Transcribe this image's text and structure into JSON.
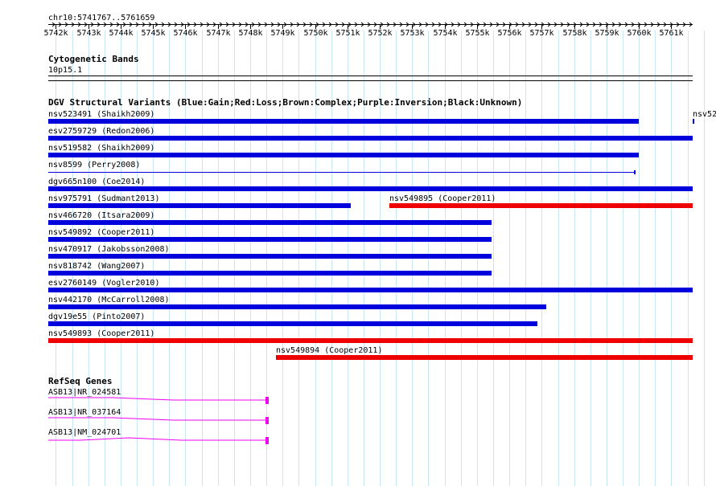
{
  "ruler": {
    "coord_label": "chr10:5741767..5761659",
    "start": 5741767,
    "end": 5761659,
    "ticks": [
      "5742k",
      "5743k",
      "5744k",
      "5745k",
      "5746k",
      "5747k",
      "5748k",
      "5749k",
      "5750k",
      "5751k",
      "5752k",
      "5753k",
      "5754k",
      "5755k",
      "5756k",
      "5757k",
      "5758k",
      "5759k",
      "5760k",
      "5761k"
    ]
  },
  "cytoband": {
    "title": "Cytogenetic Bands",
    "band": "10p15.1"
  },
  "dgv": {
    "title": "DGV Structural Variants (Blue:Gain;Red:Loss;Brown:Complex;Purple:Inversion;Black:Unknown)",
    "colors": {
      "gain": "#0000dd",
      "loss": "#ee0000"
    },
    "rows": [
      {
        "features": [
          {
            "label": "nsv523491 (Shaikh2009)",
            "start": 5741767,
            "end": 5760000,
            "type": "gain",
            "style": "thick"
          },
          {
            "label": "nsv52",
            "start": 5761670,
            "end": 5761700,
            "type": "gain",
            "style": "tiny"
          }
        ]
      },
      {
        "features": [
          {
            "label": "esv2759729 (Redon2006)",
            "start": 5741767,
            "end": 5761659,
            "type": "gain",
            "style": "thick"
          }
        ]
      },
      {
        "features": [
          {
            "label": "nsv519582 (Shaikh2009)",
            "start": 5741767,
            "end": 5760000,
            "type": "gain",
            "style": "thick"
          }
        ]
      },
      {
        "features": [
          {
            "label": "nsv8599 (Perry2008)",
            "start": 5741767,
            "end": 5759880,
            "type": "gain",
            "style": "thin"
          }
        ]
      },
      {
        "features": [
          {
            "label": "dgv665n100 (Coe2014)",
            "start": 5741767,
            "end": 5761659,
            "type": "gain",
            "style": "thick"
          }
        ]
      },
      {
        "features": [
          {
            "label": "nsv975791 (Sudmant2013)",
            "start": 5741767,
            "end": 5751105,
            "type": "gain",
            "style": "thick"
          },
          {
            "label": "nsv549895 (Cooper2011)",
            "start": 5752300,
            "end": 5761659,
            "type": "loss",
            "style": "thick"
          }
        ]
      },
      {
        "features": [
          {
            "label": "nsv466720 (Itsara2009)",
            "start": 5741767,
            "end": 5755440,
            "type": "gain",
            "style": "thick"
          }
        ]
      },
      {
        "features": [
          {
            "label": "nsv549892 (Cooper2011)",
            "start": 5741767,
            "end": 5755440,
            "type": "gain",
            "style": "thick"
          }
        ]
      },
      {
        "features": [
          {
            "label": "nsv470917 (Jakobsson2008)",
            "start": 5741767,
            "end": 5755440,
            "type": "gain",
            "style": "thick"
          }
        ]
      },
      {
        "features": [
          {
            "label": "nsv818742 (Wang2007)",
            "start": 5741767,
            "end": 5755440,
            "type": "gain",
            "style": "thick"
          }
        ]
      },
      {
        "features": [
          {
            "label": "esv2760149 (Vogler2010)",
            "start": 5741767,
            "end": 5761659,
            "type": "gain",
            "style": "thick"
          }
        ]
      },
      {
        "features": [
          {
            "label": "nsv442170 (McCarroll2008)",
            "start": 5741767,
            "end": 5757150,
            "type": "gain",
            "style": "thick"
          }
        ]
      },
      {
        "features": [
          {
            "label": "dgv19e55 (Pinto2007)",
            "start": 5741767,
            "end": 5756870,
            "type": "gain",
            "style": "thick"
          }
        ]
      },
      {
        "features": [
          {
            "label": "nsv549893 (Cooper2011)",
            "start": 5741767,
            "end": 5761659,
            "type": "loss",
            "style": "thick"
          }
        ]
      },
      {
        "features": [
          {
            "label": "nsv549894 (Cooper2011)",
            "start": 5748800,
            "end": 5761659,
            "type": "loss",
            "style": "thick"
          }
        ]
      }
    ]
  },
  "refseq": {
    "title": "RefSeq Genes",
    "color": "#ee00ee",
    "genes": [
      {
        "label": "ASB13|NR_024581",
        "start": 5741767,
        "end": 5748560,
        "shape": "down"
      },
      {
        "label": "ASB13|NR_037164",
        "start": 5741767,
        "end": 5748560,
        "shape": "down"
      },
      {
        "label": "ASB13|NM_024701",
        "start": 5741767,
        "end": 5748560,
        "shape": "up"
      }
    ]
  }
}
